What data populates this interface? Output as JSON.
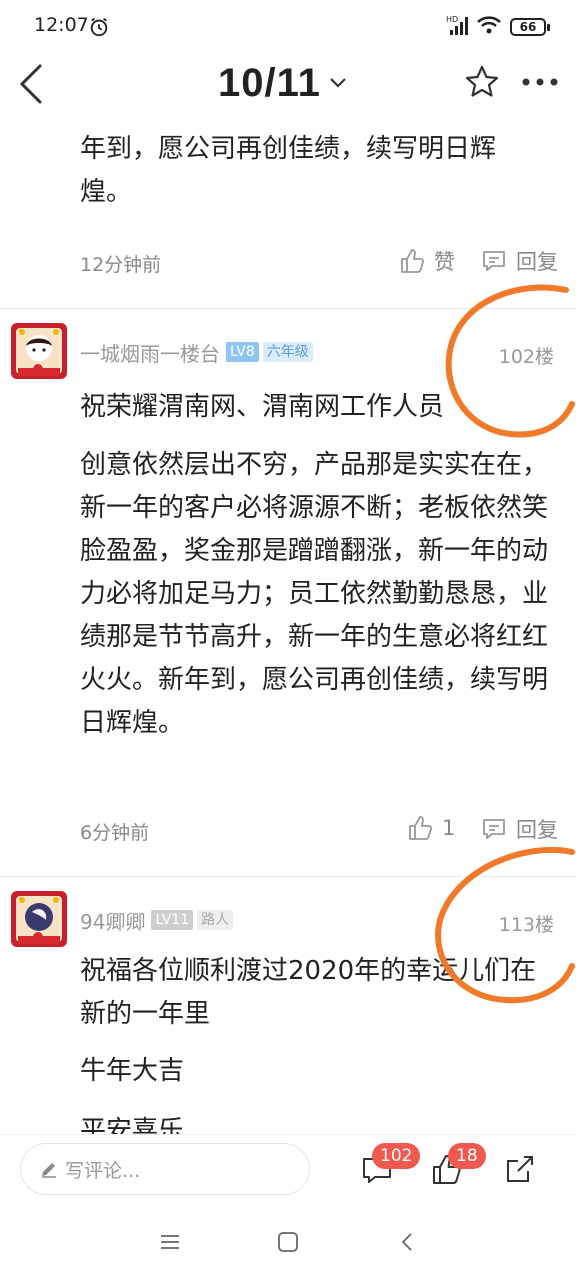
{
  "status": {
    "time": "12:07",
    "battery": "66",
    "network": "HD"
  },
  "nav": {
    "page_current": "10/11"
  },
  "posts": [
    {
      "tail_text": "年到，愿公司再创佳绩，续写明日辉煌。",
      "time": "12分钟前",
      "like_label": "赞",
      "reply_label": "回复"
    },
    {
      "username": "一城烟雨一楼台",
      "level": "LV8",
      "grade": "六年级",
      "floor": "102楼",
      "title": "祝荣耀渭南网、渭南网工作人员",
      "body": "创意依然层出不穷，产品那是实实在在，新一年的客户必将源源不断；老板依然笑脸盈盈，奖金那是蹭蹭翻涨，新一年的动力必将加足马力；员工依然勤勤恳恳，业绩那是节节高升，新一年的生意必将红红火火。新年到，愿公司再创佳绩，续写明日辉煌。",
      "time": "6分钟前",
      "like_count": "1",
      "reply_label": "回复"
    },
    {
      "username": "94卿卿",
      "level": "LV11",
      "grade": "路人",
      "floor": "113楼",
      "lines": [
        "祝福各位顺利渡过2020年的幸运儿们在新的一年里",
        "牛年大吉",
        "平安喜乐"
      ]
    }
  ],
  "comment_bar": {
    "placeholder": "写评论...",
    "comment_count": "102",
    "like_count": "18"
  },
  "colors": {
    "accent": "#f05a4e",
    "highlight": "#f07a2a",
    "badge_blue": "#8fc5f4"
  }
}
